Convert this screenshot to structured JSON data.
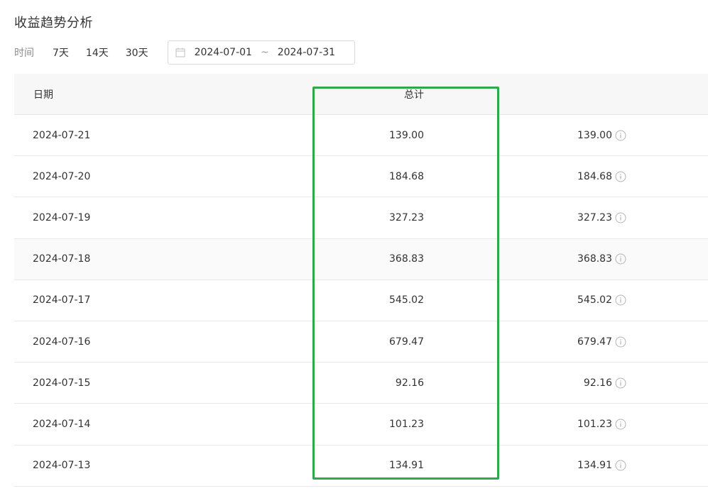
{
  "page": {
    "title": "收益趋势分析"
  },
  "filter": {
    "label": "时间",
    "ranges": [
      "7天",
      "14天",
      "30天"
    ],
    "date_start": "2024-07-01",
    "date_sep": "~",
    "date_end": "2024-07-31"
  },
  "table": {
    "headers": {
      "date": "日期",
      "total": "总计",
      "blurred": ""
    },
    "rows": [
      {
        "date": "2024-07-21",
        "total": "139.00",
        "amount": "139.00"
      },
      {
        "date": "2024-07-20",
        "total": "184.68",
        "amount": "184.68"
      },
      {
        "date": "2024-07-19",
        "total": "327.23",
        "amount": "327.23"
      },
      {
        "date": "2024-07-18",
        "total": "368.83",
        "amount": "368.83"
      },
      {
        "date": "2024-07-17",
        "total": "545.02",
        "amount": "545.02"
      },
      {
        "date": "2024-07-16",
        "total": "679.47",
        "amount": "679.47"
      },
      {
        "date": "2024-07-15",
        "total": "92.16",
        "amount": "92.16"
      },
      {
        "date": "2024-07-14",
        "total": "101.23",
        "amount": "101.23"
      },
      {
        "date": "2024-07-13",
        "total": "134.91",
        "amount": "134.91"
      }
    ]
  },
  "colors": {
    "highlight_box": "#2ea84a",
    "header_bg": "#f7f7f7",
    "row_hover_bg": "#fafafa",
    "border": "#e8e8e8"
  },
  "icons": {
    "date_picker": "calendar-icon",
    "row_info": "info-circle-icon"
  }
}
